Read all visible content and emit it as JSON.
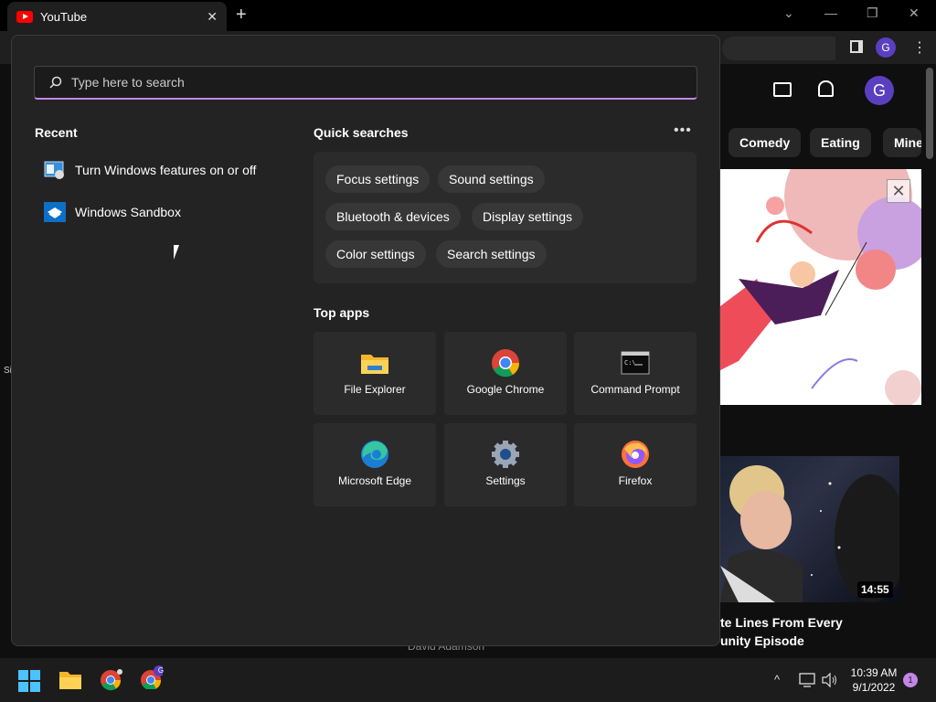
{
  "browser": {
    "tab_title": "YouTube",
    "tab_close": "✕",
    "new_tab": "+",
    "profile_initial": "G",
    "menu_dots": "⋮",
    "win_minimize": "—",
    "win_restore": "❐",
    "win_close": "✕",
    "win_chevron": "⌄"
  },
  "youtube": {
    "avatar_initial": "G",
    "chips": [
      "Comedy",
      "Eating",
      "Mine"
    ],
    "ad_close": "✕",
    "duration": "14:55",
    "video_title_line1": "te Lines From Every",
    "video_title_line2": "unity Episode",
    "behind_text": "David Adamson",
    "left_edge": "Si"
  },
  "start_menu": {
    "search_placeholder": "Type here to search",
    "recent_title": "Recent",
    "recent_items": [
      {
        "label": "Turn Windows features on or off"
      },
      {
        "label": "Windows Sandbox"
      }
    ],
    "quick_searches_title": "Quick searches",
    "more_dots": "•••",
    "quick_searches": [
      "Focus settings",
      "Sound settings",
      "Bluetooth & devices",
      "Display settings",
      "Color settings",
      "Search settings"
    ],
    "top_apps_title": "Top apps",
    "top_apps": [
      {
        "label": "File Explorer",
        "icon": "folder-icon"
      },
      {
        "label": "Google Chrome",
        "icon": "chrome-icon"
      },
      {
        "label": "Command Prompt",
        "icon": "terminal-icon"
      },
      {
        "label": "Microsoft Edge",
        "icon": "edge-icon"
      },
      {
        "label": "Settings",
        "icon": "gear-icon"
      },
      {
        "label": "Firefox",
        "icon": "firefox-icon"
      }
    ]
  },
  "taskbar": {
    "time": "10:39 AM",
    "date": "9/1/2022",
    "notification_count": "1",
    "chevron": "^",
    "profile_badge": "G"
  },
  "colors": {
    "accent": "#c387e8",
    "panel": "#232323",
    "youtube_red": "#ff0000",
    "avatar_purple": "#5a3fc0"
  }
}
